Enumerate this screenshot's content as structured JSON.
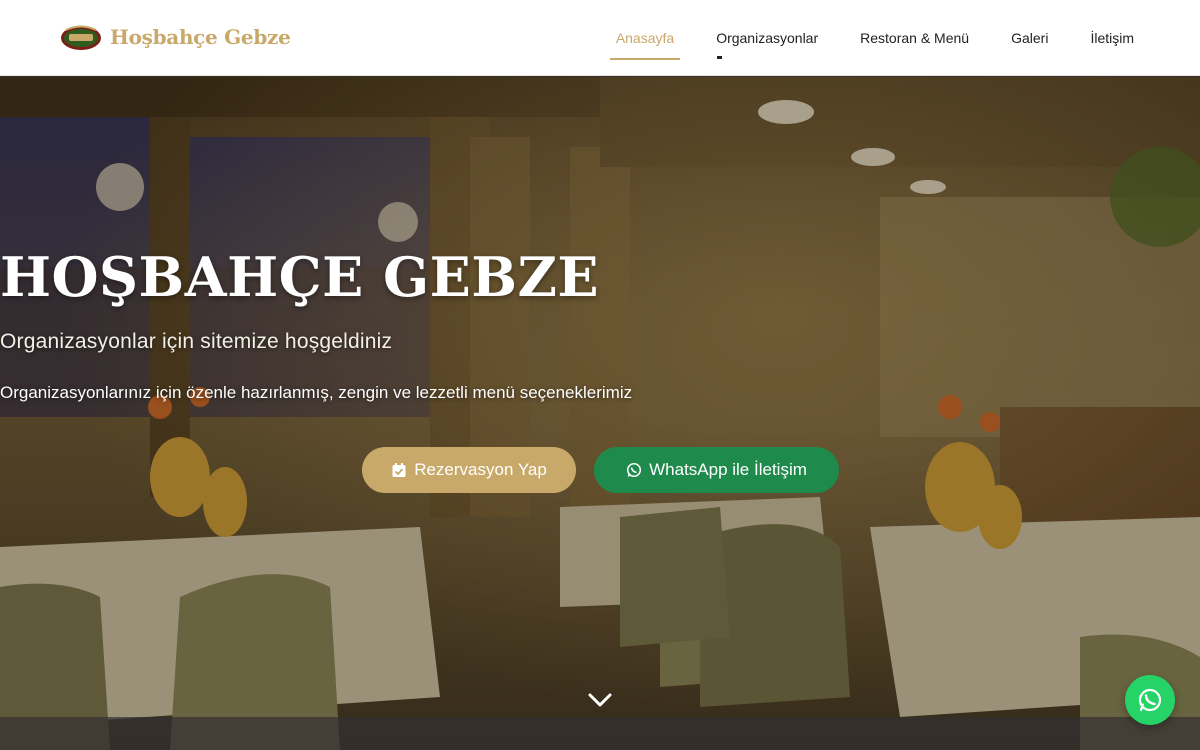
{
  "brand": {
    "name": "Hoşbahçe Gebze",
    "color": "#c8a96a"
  },
  "nav": {
    "items": [
      {
        "label": "Anasayfa",
        "active": true
      },
      {
        "label": "Organizasyonlar",
        "active": false
      },
      {
        "label": "Restoran & Menü",
        "active": false
      },
      {
        "label": "Galeri",
        "active": false
      },
      {
        "label": "İletişim",
        "active": false
      }
    ]
  },
  "hero": {
    "title": "HOŞBAHÇE GEBZE",
    "subtitle": "Organizasyonlar için sitemize hoşgeldiniz",
    "description": "Organizasyonlarınız için özenle hazırlanmış, zengin ve lezzetli menü seçeneklerimiz",
    "buttons": {
      "reserve_label": "Rezervasyon Yap",
      "reserve_icon": "calendar-check-icon",
      "whatsapp_label": "WhatsApp ile İletişim",
      "whatsapp_icon": "whatsapp-icon"
    },
    "scroll_icon": "chevron-down-icon"
  },
  "floating": {
    "whatsapp_icon": "whatsapp-icon",
    "color": "#25d366"
  },
  "colors": {
    "accent": "#c8a96a",
    "whatsapp_button": "#1e8a4c"
  }
}
